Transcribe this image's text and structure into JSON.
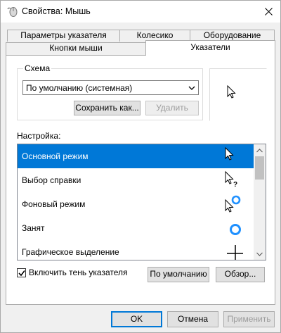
{
  "window": {
    "title": "Свойства: Мышь",
    "close_icon": "close-icon"
  },
  "tabs": {
    "row_back": [
      {
        "label": "Параметры указателя"
      },
      {
        "label": "Колесико"
      },
      {
        "label": "Оборудование"
      }
    ],
    "row_front": [
      {
        "label": "Кнопки мыши"
      },
      {
        "label": "Указатели",
        "active": true
      }
    ]
  },
  "scheme": {
    "legend": "Схема",
    "selected": "По умолчанию (системная)",
    "save_as_label": "Сохранить как...",
    "delete_label": "Удалить"
  },
  "settings": {
    "label": "Настройка:",
    "items": [
      {
        "label": "Основной режим",
        "icon": "arrow-cursor-icon",
        "selected": true
      },
      {
        "label": "Выбор справки",
        "icon": "help-cursor-icon"
      },
      {
        "label": "Фоновый режим",
        "icon": "working-in-background-cursor-icon"
      },
      {
        "label": "Занят",
        "icon": "busy-cursor-icon"
      },
      {
        "label": "Графическое выделение",
        "icon": "precision-select-cursor-icon"
      }
    ]
  },
  "options": {
    "shadow_label": "Включить тень указателя",
    "shadow_checked": true,
    "default_label": "По умолчанию",
    "browse_label": "Обзор..."
  },
  "footer": {
    "ok_label": "OK",
    "cancel_label": "Отмена",
    "apply_label": "Применить"
  },
  "colors": {
    "selection": "#0078d7",
    "busy_ring": "#1e90ff"
  }
}
